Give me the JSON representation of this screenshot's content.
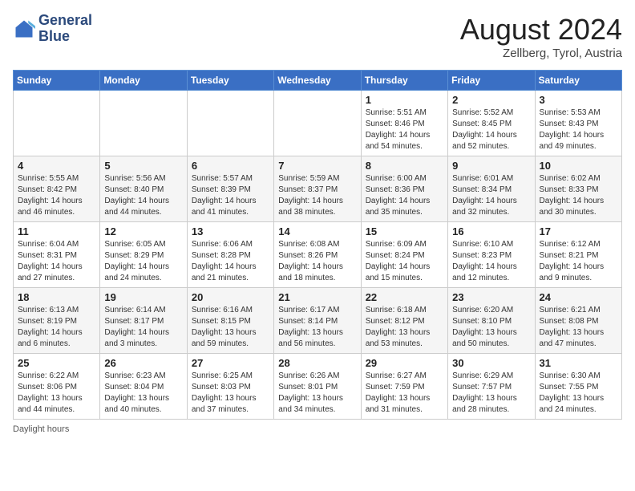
{
  "header": {
    "logo_line1": "General",
    "logo_line2": "Blue",
    "month_year": "August 2024",
    "location": "Zellberg, Tyrol, Austria"
  },
  "days_of_week": [
    "Sunday",
    "Monday",
    "Tuesday",
    "Wednesday",
    "Thursday",
    "Friday",
    "Saturday"
  ],
  "weeks": [
    [
      {
        "day": "",
        "info": ""
      },
      {
        "day": "",
        "info": ""
      },
      {
        "day": "",
        "info": ""
      },
      {
        "day": "",
        "info": ""
      },
      {
        "day": "1",
        "info": "Sunrise: 5:51 AM\nSunset: 8:46 PM\nDaylight: 14 hours\nand 54 minutes."
      },
      {
        "day": "2",
        "info": "Sunrise: 5:52 AM\nSunset: 8:45 PM\nDaylight: 14 hours\nand 52 minutes."
      },
      {
        "day": "3",
        "info": "Sunrise: 5:53 AM\nSunset: 8:43 PM\nDaylight: 14 hours\nand 49 minutes."
      }
    ],
    [
      {
        "day": "4",
        "info": "Sunrise: 5:55 AM\nSunset: 8:42 PM\nDaylight: 14 hours\nand 46 minutes."
      },
      {
        "day": "5",
        "info": "Sunrise: 5:56 AM\nSunset: 8:40 PM\nDaylight: 14 hours\nand 44 minutes."
      },
      {
        "day": "6",
        "info": "Sunrise: 5:57 AM\nSunset: 8:39 PM\nDaylight: 14 hours\nand 41 minutes."
      },
      {
        "day": "7",
        "info": "Sunrise: 5:59 AM\nSunset: 8:37 PM\nDaylight: 14 hours\nand 38 minutes."
      },
      {
        "day": "8",
        "info": "Sunrise: 6:00 AM\nSunset: 8:36 PM\nDaylight: 14 hours\nand 35 minutes."
      },
      {
        "day": "9",
        "info": "Sunrise: 6:01 AM\nSunset: 8:34 PM\nDaylight: 14 hours\nand 32 minutes."
      },
      {
        "day": "10",
        "info": "Sunrise: 6:02 AM\nSunset: 8:33 PM\nDaylight: 14 hours\nand 30 minutes."
      }
    ],
    [
      {
        "day": "11",
        "info": "Sunrise: 6:04 AM\nSunset: 8:31 PM\nDaylight: 14 hours\nand 27 minutes."
      },
      {
        "day": "12",
        "info": "Sunrise: 6:05 AM\nSunset: 8:29 PM\nDaylight: 14 hours\nand 24 minutes."
      },
      {
        "day": "13",
        "info": "Sunrise: 6:06 AM\nSunset: 8:28 PM\nDaylight: 14 hours\nand 21 minutes."
      },
      {
        "day": "14",
        "info": "Sunrise: 6:08 AM\nSunset: 8:26 PM\nDaylight: 14 hours\nand 18 minutes."
      },
      {
        "day": "15",
        "info": "Sunrise: 6:09 AM\nSunset: 8:24 PM\nDaylight: 14 hours\nand 15 minutes."
      },
      {
        "day": "16",
        "info": "Sunrise: 6:10 AM\nSunset: 8:23 PM\nDaylight: 14 hours\nand 12 minutes."
      },
      {
        "day": "17",
        "info": "Sunrise: 6:12 AM\nSunset: 8:21 PM\nDaylight: 14 hours\nand 9 minutes."
      }
    ],
    [
      {
        "day": "18",
        "info": "Sunrise: 6:13 AM\nSunset: 8:19 PM\nDaylight: 14 hours\nand 6 minutes."
      },
      {
        "day": "19",
        "info": "Sunrise: 6:14 AM\nSunset: 8:17 PM\nDaylight: 14 hours\nand 3 minutes."
      },
      {
        "day": "20",
        "info": "Sunrise: 6:16 AM\nSunset: 8:15 PM\nDaylight: 13 hours\nand 59 minutes."
      },
      {
        "day": "21",
        "info": "Sunrise: 6:17 AM\nSunset: 8:14 PM\nDaylight: 13 hours\nand 56 minutes."
      },
      {
        "day": "22",
        "info": "Sunrise: 6:18 AM\nSunset: 8:12 PM\nDaylight: 13 hours\nand 53 minutes."
      },
      {
        "day": "23",
        "info": "Sunrise: 6:20 AM\nSunset: 8:10 PM\nDaylight: 13 hours\nand 50 minutes."
      },
      {
        "day": "24",
        "info": "Sunrise: 6:21 AM\nSunset: 8:08 PM\nDaylight: 13 hours\nand 47 minutes."
      }
    ],
    [
      {
        "day": "25",
        "info": "Sunrise: 6:22 AM\nSunset: 8:06 PM\nDaylight: 13 hours\nand 44 minutes."
      },
      {
        "day": "26",
        "info": "Sunrise: 6:23 AM\nSunset: 8:04 PM\nDaylight: 13 hours\nand 40 minutes."
      },
      {
        "day": "27",
        "info": "Sunrise: 6:25 AM\nSunset: 8:03 PM\nDaylight: 13 hours\nand 37 minutes."
      },
      {
        "day": "28",
        "info": "Sunrise: 6:26 AM\nSunset: 8:01 PM\nDaylight: 13 hours\nand 34 minutes."
      },
      {
        "day": "29",
        "info": "Sunrise: 6:27 AM\nSunset: 7:59 PM\nDaylight: 13 hours\nand 31 minutes."
      },
      {
        "day": "30",
        "info": "Sunrise: 6:29 AM\nSunset: 7:57 PM\nDaylight: 13 hours\nand 28 minutes."
      },
      {
        "day": "31",
        "info": "Sunrise: 6:30 AM\nSunset: 7:55 PM\nDaylight: 13 hours\nand 24 minutes."
      }
    ]
  ],
  "footer": {
    "note": "Daylight hours"
  }
}
